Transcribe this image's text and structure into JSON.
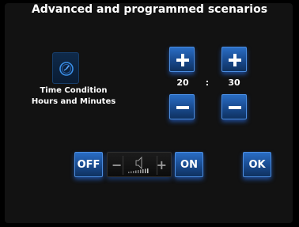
{
  "title": "Advanced and programmed scenarios",
  "time_condition": {
    "label_line1": "Time Condition",
    "label_line2": "Hours and Minutes",
    "icon": "clock-icon",
    "hours": "20",
    "separator": ":",
    "minutes": "30"
  },
  "controls": {
    "off_label": "OFF",
    "on_label": "ON",
    "ok_label": "OK",
    "volume_minus": "−",
    "volume_plus": "+"
  },
  "colors": {
    "accent": "#2a6dc4",
    "background": "#121212"
  }
}
